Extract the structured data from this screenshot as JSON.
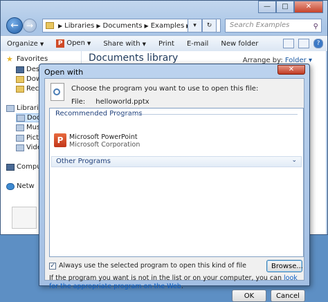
{
  "explorer": {
    "breadcrumb": [
      "Libraries",
      "Documents",
      "Examples"
    ],
    "search_placeholder": "Search Examples",
    "toolbar": {
      "organize": "Organize",
      "open": "Open",
      "share_with": "Share with",
      "print": "Print",
      "email": "E-mail",
      "new_folder": "New folder"
    },
    "nav": {
      "favorites": "Favorites",
      "desktop": "Desk",
      "downloads": "Dow",
      "recent": "Rece",
      "libraries": "Librari",
      "documents": "Doc",
      "music": "Mus",
      "pictures": "Pict",
      "videos": "Video",
      "computer": "Compu",
      "network": "Netw"
    },
    "library_title": "Documents library",
    "arrange_by_label": "Arrange by:",
    "arrange_by_value": "Folder"
  },
  "dialog": {
    "title": "Open with",
    "prompt": "Choose the program you want to use to open this file:",
    "file_label": "File:",
    "file_name": "helloworld.pptx",
    "recommended_header": "Recommended Programs",
    "program_name": "Microsoft PowerPoint",
    "program_company": "Microsoft Corporation",
    "other_header": "Other Programs",
    "always_use_label": "Always use the selected program to open this kind of file",
    "always_use_checked": true,
    "browse_label": "Browse...",
    "info_text": "If the program you want is not in the list or on your computer, you can",
    "info_link": "look for the appropriate program on the Web",
    "info_end": ".",
    "ok_label": "OK",
    "cancel_label": "Cancel"
  }
}
